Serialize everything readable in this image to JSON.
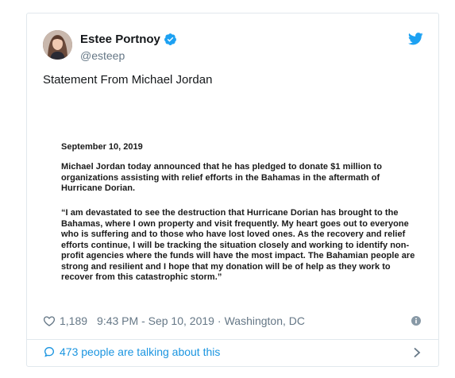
{
  "author": {
    "name": "Estee Portnoy",
    "handle": "@esteep"
  },
  "tweet": {
    "text": "Statement From Michael Jordan"
  },
  "statement": {
    "date": "September 10, 2019",
    "paragraph1": "Michael Jordan today announced that he has pledged to donate $1 million to organizations assisting with relief efforts in the Bahamas in the aftermath of Hurricane Dorian.",
    "paragraph2": "“I am devastated to see the destruction that Hurricane Dorian has brought to the Bahamas, where I own property and visit frequently.  My heart goes out to everyone who is suffering and to those who have lost loved ones. As the recovery and relief efforts continue, I will be tracking the situation closely and working to identify non-profit agencies where the funds will have the most impact. The Bahamian people are strong and resilient and I hope that my donation will be of help as they work to recover from this catastrophic storm.”"
  },
  "meta": {
    "likes": "1,189",
    "time": "9:43 PM - Sep 10, 2019",
    "separator": "·",
    "location": "Washington, DC"
  },
  "footer": {
    "talking": "473 people are talking about this"
  },
  "icons": {
    "verified": "verified-badge-icon",
    "brand": "twitter-bird-icon",
    "like": "heart-icon",
    "info": "info-icon",
    "conversation": "speech-bubble-icon",
    "chevron": "chevron-right-icon"
  },
  "colors": {
    "accent": "#1da1f2",
    "link": "#1b95e0",
    "muted": "#657786",
    "border": "#e1e8ed"
  }
}
